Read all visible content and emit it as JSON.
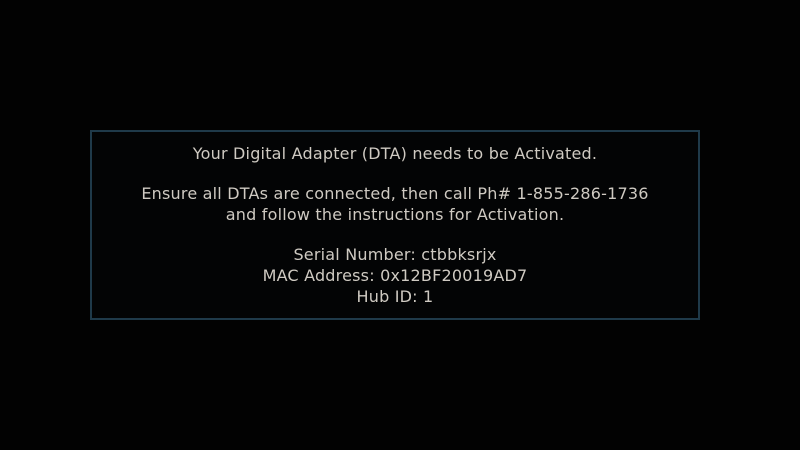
{
  "activation_dialog": {
    "heading": "Your Digital Adapter (DTA) needs to be Activated.",
    "instruction_line1": "Ensure all DTAs are connected, then call Ph# 1-855-286-1736",
    "instruction_line2": "and follow the instructions for Activation.",
    "serial_number": "Serial Number: ctbbksrjx",
    "mac_address": "MAC Address: 0x12BF20019AD7",
    "hub_id": "Hub ID: 1"
  },
  "colors": {
    "background": "#020202",
    "border": "#1f3a4a",
    "text": "#cfcac2"
  }
}
